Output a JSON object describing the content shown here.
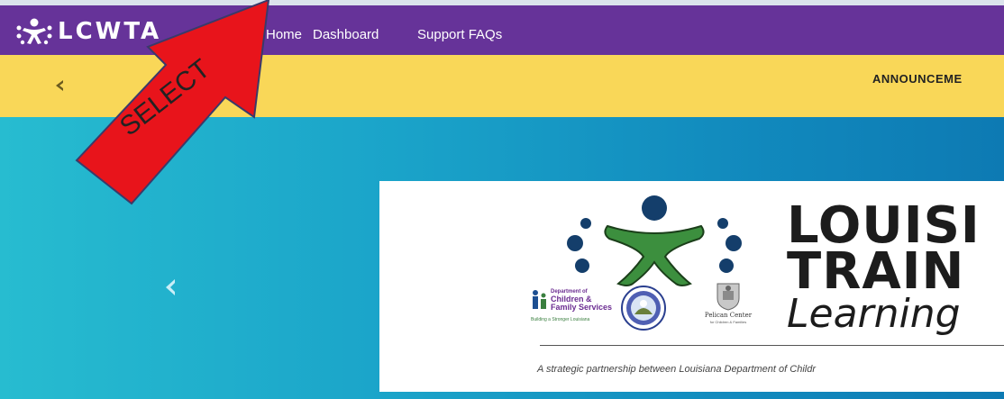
{
  "navbar": {
    "brand": "LCWTA",
    "brand_icon": "people-circle-icon",
    "links": [
      "Home",
      "Dashboard",
      "Support FAQs"
    ],
    "background": "#663399"
  },
  "announcements": {
    "title": "ANNOUNCEME",
    "prev_icon": "chevron-left-icon",
    "background": "#f9d758"
  },
  "hero": {
    "prev_icon": "chevron-left-icon",
    "card": {
      "title_line1": "LOUISI",
      "title_line2": "TRAIN",
      "title_line3": "Learning",
      "partner_dcfs": {
        "line1": "Department of",
        "line2": "Children &",
        "line3": "Family Services",
        "tagline": "Building a Stronger Louisiana"
      },
      "partner_pelican": {
        "name": "Pelican Center",
        "sub": "for Children & Families"
      },
      "tagline": "A strategic partnership between Louisiana Department of Childr"
    }
  },
  "annotation": {
    "text": "SELECT",
    "color": "#e8141b"
  }
}
